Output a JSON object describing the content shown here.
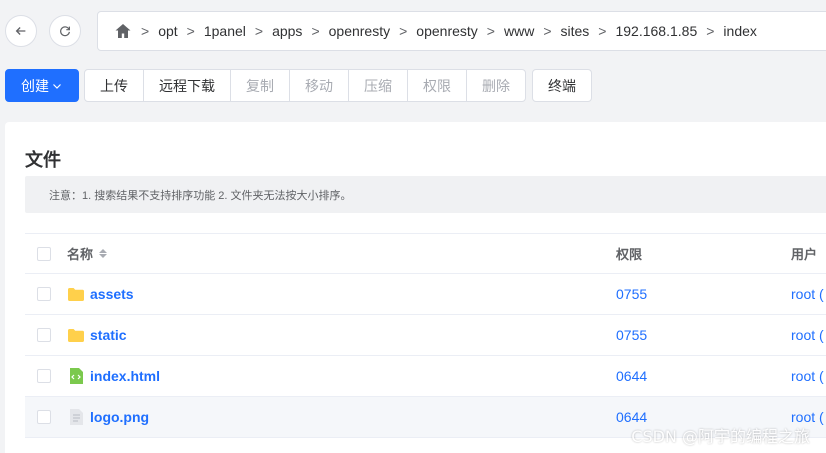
{
  "nav": {
    "back_icon": "arrow-left-icon",
    "refresh_icon": "refresh-icon",
    "home_icon": "home-icon",
    "separator": ">",
    "path": [
      "opt",
      "1panel",
      "apps",
      "openresty",
      "openresty",
      "www",
      "sites",
      "192.168.1.85",
      "index"
    ]
  },
  "toolbar": {
    "create_label": "创建",
    "upload_label": "上传",
    "remote_download_label": "远程下载",
    "copy_label": "复制",
    "move_label": "移动",
    "compress_label": "压缩",
    "permission_label": "权限",
    "delete_label": "删除",
    "terminal_label": "终端"
  },
  "card": {
    "title": "文件",
    "notice": "注意：1. 搜索结果不支持排序功能 2. 文件夹无法按大小排序。"
  },
  "table": {
    "columns": {
      "name": "名称",
      "permission": "权限",
      "user": "用户"
    },
    "rows": [
      {
        "name": "assets",
        "type": "folder",
        "permission": "0755",
        "user": "root ("
      },
      {
        "name": "static",
        "type": "folder",
        "permission": "0755",
        "user": "root ("
      },
      {
        "name": "index.html",
        "type": "html",
        "permission": "0644",
        "user": "root ("
      },
      {
        "name": "logo.png",
        "type": "file",
        "permission": "0644",
        "user": "root ("
      }
    ]
  },
  "watermark": "CSDN @阿宇的编程之旅",
  "colors": {
    "primary": "#1f6fff",
    "folder": "#ffd04b",
    "html_file": "#7bc94d"
  }
}
